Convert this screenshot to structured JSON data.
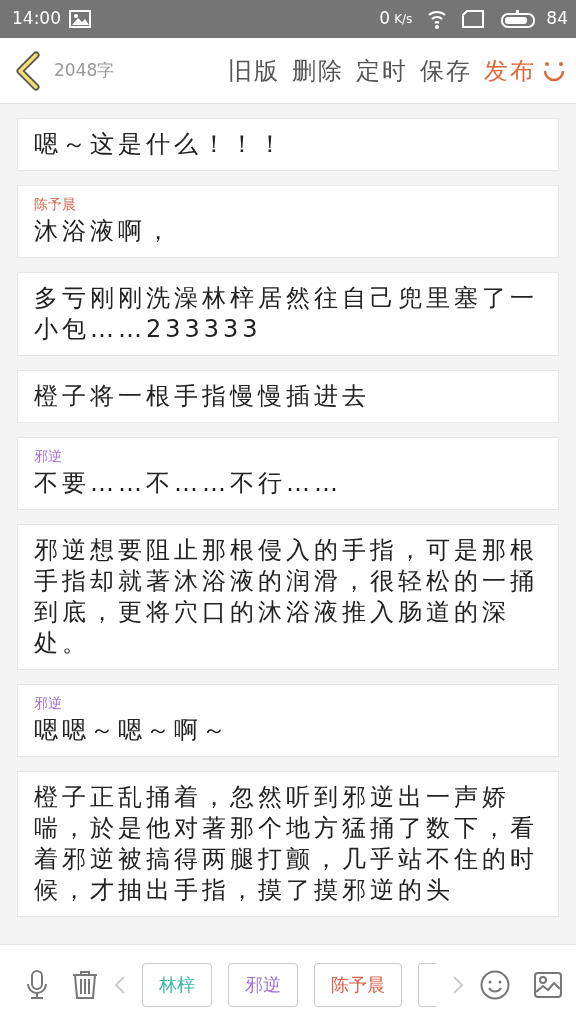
{
  "status_bar": {
    "time": "14:00",
    "speed": "0",
    "speed_unit": "K/s",
    "battery": "84"
  },
  "header": {
    "word_count": "2048字",
    "actions": [
      {
        "label": "旧版",
        "kind": "normal"
      },
      {
        "label": "删除",
        "kind": "normal"
      },
      {
        "label": "定时",
        "kind": "normal"
      },
      {
        "label": "保存",
        "kind": "normal"
      },
      {
        "label": "发布",
        "kind": "primary"
      }
    ]
  },
  "blocks": [
    {
      "text": "嗯～这是什么！！！"
    },
    {
      "speaker": "陈予晨",
      "color": "#d9604a",
      "text": "沐浴液啊，"
    },
    {
      "text": "多亏刚刚洗澡林梓居然往自己兜里塞了一小包……233333"
    },
    {
      "text": "橙子将一根手指慢慢插进去"
    },
    {
      "speaker": "邪逆",
      "color": "#a070d0",
      "text": "不要……不……不行……"
    },
    {
      "text": "邪逆想要阻止那根侵入的手指，可是那根手指却就著沐浴液的润滑，很轻松的一捅到底，更将穴口的沐浴液推入肠道的深处。"
    },
    {
      "speaker": "邪逆",
      "color": "#a070d0",
      "text": "嗯嗯～嗯～啊～"
    },
    {
      "text": "橙子正乱捅着，忽然听到邪逆出一声娇喘，於是他对著那个地方猛捅了数下，看着邪逆被搞得两腿打颤，几乎站不住的时候，才抽出手指，摸了摸邪逆的头"
    }
  ],
  "characters": [
    {
      "name": "林梓",
      "color": "#3bb7a8"
    },
    {
      "name": "邪逆",
      "color": "#a070d0"
    },
    {
      "name": "陈予晨",
      "color": "#d9604a"
    }
  ]
}
